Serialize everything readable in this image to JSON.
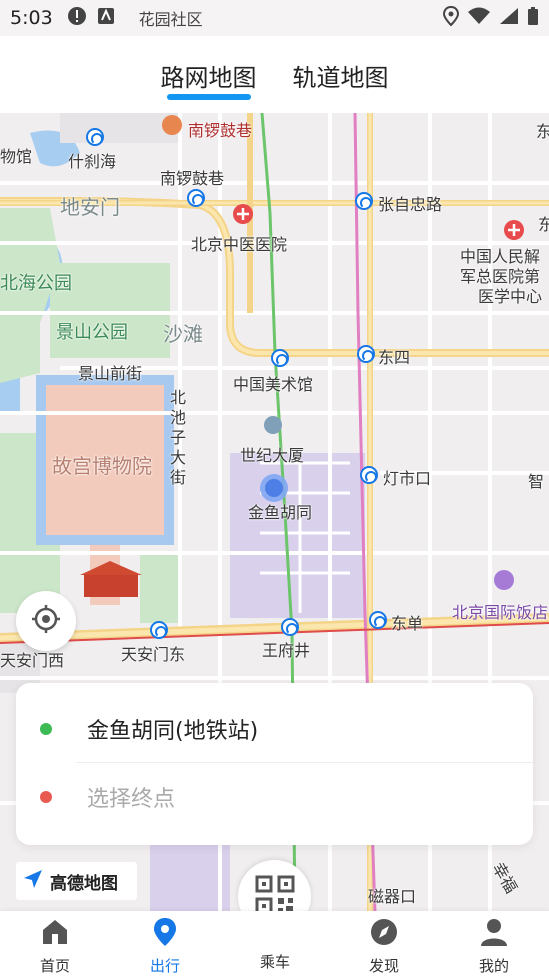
{
  "status": {
    "time": "5:03",
    "carrier": "花园社区"
  },
  "tabs": [
    {
      "label": "路网地图",
      "active": true
    },
    {
      "label": "轨道地图",
      "active": false
    }
  ],
  "map": {
    "labels": {
      "nanluoguxiang_top": "南锣鼓巷",
      "nanluoguxiang": "南锣鼓巷",
      "shichahai": "什刹海",
      "guan": "物馆",
      "dianmen": "地安门",
      "zhangzizhong": "张自忠路",
      "tcm_hospital": "北京中医医院",
      "pla_hospital_1": "中国人民解",
      "pla_hospital_2": "军总医院第",
      "pla_hospital_3": "医学中心",
      "beihai": "北海公园",
      "jingshan": "景山公园",
      "shatan": "沙滩",
      "dongsi": "东四",
      "art_museum": "中国美术馆",
      "jingshanqian": "景山前街",
      "beichizi": "北池子大街",
      "palace_museum": "故宫博物院",
      "century_tower": "世纪大厦",
      "dengshikou": "灯市口",
      "jinyu": "金鱼胡同",
      "zhi": "智",
      "intl_hotel": "北京国际饭店",
      "dongdan": "东单",
      "wangfujing": "王府井",
      "tiananmen_east": "天安门东",
      "tiananmen_west": "天安门西",
      "ciqikou": "磁器口",
      "xingfu": "幸福",
      "top_right": "东",
      "right_edge": "东"
    }
  },
  "route": {
    "start": "金鱼胡同(地铁站)",
    "end_placeholder": "选择终点",
    "start_color": "#3cba54",
    "end_color": "#e85a4f"
  },
  "amap_logo": "高德地图",
  "nav": [
    {
      "label": "首页",
      "icon": "home-icon",
      "active": false
    },
    {
      "label": "出行",
      "icon": "location-pin-icon",
      "active": true
    },
    {
      "label": "乘车",
      "icon": "qr-code-icon",
      "active": false
    },
    {
      "label": "发现",
      "icon": "compass-icon",
      "active": false
    },
    {
      "label": "我的",
      "icon": "user-icon",
      "active": false
    }
  ],
  "colors": {
    "accent": "#1677e6",
    "tab_indicator": "#1296f2"
  }
}
